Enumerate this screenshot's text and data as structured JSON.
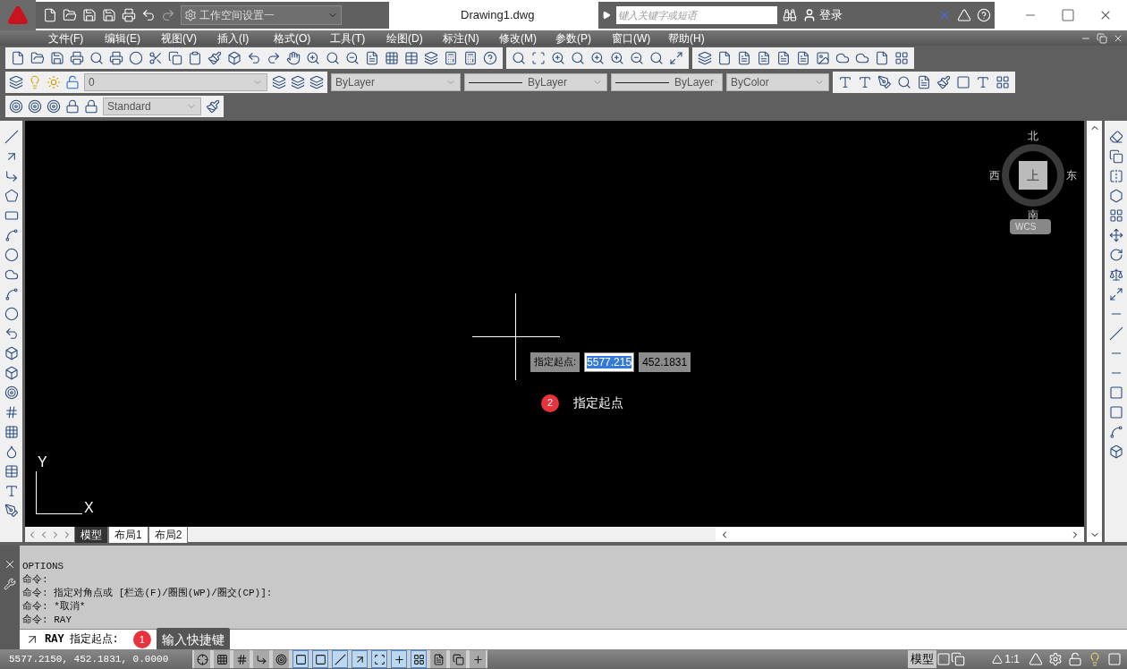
{
  "title_bar": {
    "title": "Drawing1.dwg",
    "workspace": "工作空间设置一",
    "search": {
      "placeholder": "键入关键字或短语"
    },
    "login": "登录"
  },
  "menu": [
    "文件(F)",
    "编辑(E)",
    "视图(V)",
    "插入(I)",
    "格式(O)",
    "工具(T)",
    "绘图(D)",
    "标注(N)",
    "修改(M)",
    "参数(P)",
    "窗口(W)",
    "帮助(H)"
  ],
  "layer_toolbar": {
    "layer": "0",
    "color_control": "ByLayer",
    "linetype": "ByLayer",
    "lineweight": "ByLayer",
    "plot_style": "ByColor"
  },
  "style_toolbar": {
    "style": "Standard"
  },
  "canvas": {
    "prompt": {
      "label": "指定起点:",
      "x_value": "5577.215",
      "y_value": "452.1831"
    },
    "callout": {
      "number": "2",
      "text": "指定起点"
    },
    "compass": {
      "north": "北",
      "west": "西",
      "east": "东",
      "south": "南",
      "center": "上",
      "ucs": "WCS"
    },
    "axes": {
      "y": "Y",
      "x": "X"
    }
  },
  "layout_tabs": [
    {
      "label": "模型",
      "selected": true
    },
    {
      "label": "布局1",
      "selected": false
    },
    {
      "label": "布局2",
      "selected": false
    }
  ],
  "command_history": [
    "OPTIONS",
    "命令:",
    "命令: 指定对角点或 [栏选(F)/圈围(WP)/圈交(CP)]:",
    "命令: *取消*",
    "命令: RAY"
  ],
  "command_line": {
    "command": "RAY",
    "prompt": "指定起点:",
    "callout": {
      "number": "1",
      "text": "输入快捷键"
    }
  },
  "status_bar": {
    "coordinates": "5577.2150, 452.1831, 0.0000",
    "toggles": [
      {
        "on": false
      },
      {
        "on": false
      },
      {
        "on": false
      },
      {
        "on": false
      },
      {
        "on": false
      },
      {
        "on": true
      },
      {
        "on": true
      },
      {
        "on": true
      },
      {
        "on": true
      },
      {
        "on": true
      },
      {
        "on": true
      },
      {
        "on": true
      },
      {
        "on": false
      },
      {
        "on": false
      },
      {
        "on": false
      }
    ],
    "model": "模型",
    "scale": "1:1"
  }
}
